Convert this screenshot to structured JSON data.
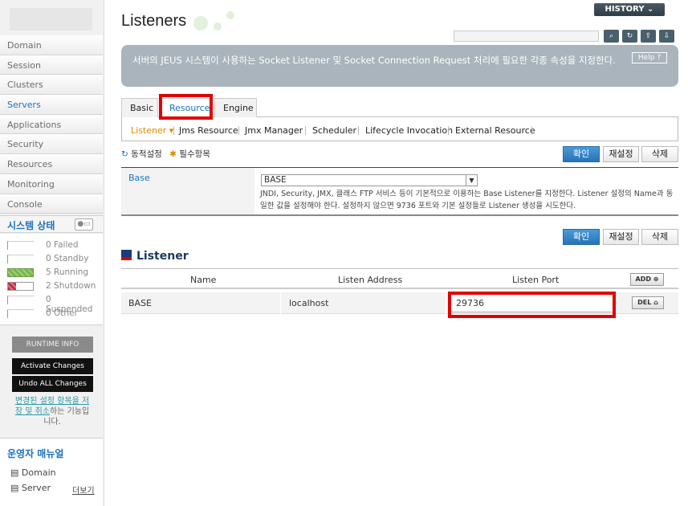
{
  "sidebar": {
    "items": [
      {
        "label": "Domain",
        "active": false
      },
      {
        "label": "Session",
        "active": false
      },
      {
        "label": "Clusters",
        "active": false
      },
      {
        "label": "Servers",
        "active": true
      },
      {
        "label": "Applications",
        "active": false
      },
      {
        "label": "Security",
        "active": false
      },
      {
        "label": "Resources",
        "active": false
      },
      {
        "label": "Monitoring",
        "active": false
      },
      {
        "label": "Console",
        "active": false
      }
    ],
    "system_status": {
      "title": "시스템 상태",
      "rows": [
        {
          "count": "0",
          "label": "Failed"
        },
        {
          "count": "0",
          "label": "Standby"
        },
        {
          "count": "5",
          "label": "Running"
        },
        {
          "count": "2",
          "label": "Shutdown"
        },
        {
          "count": "0",
          "label": "Suspended"
        },
        {
          "count": "0",
          "label": "Other"
        }
      ]
    },
    "runtime_info_label": "RUNTIME INFO",
    "activate_label": "Activate Changes",
    "undo_label": "Undo ALL Changes",
    "note_link": "변경된 설정 항목을 저장 및 취소",
    "note_rest": "하는 기능입니다.",
    "manual": {
      "title": "운영자 매뉴얼",
      "links": [
        "Domain",
        "Server"
      ],
      "more": "더보기"
    }
  },
  "header": {
    "title": "Listeners",
    "history_label": "HISTORY",
    "description": "서버의 JEUS 시스템이 사용하는 Socket Listener 및 Socket Connection Request 처리에 필요한 각종 속성을 지정한다.",
    "help_label": "Help"
  },
  "tabs": [
    "Basic",
    "Resource",
    "Engine"
  ],
  "subnav": [
    "Listener",
    "Jms Resource",
    "Jmx Manager",
    "Scheduler",
    "Lifecycle Invocation",
    "External Resource"
  ],
  "legend": {
    "dynamic": "동적설정",
    "required": "필수항목"
  },
  "buttons": {
    "ok": "확인",
    "reset": "재설정",
    "delete": "삭제"
  },
  "form": {
    "label": "Base",
    "value": "BASE",
    "description": "JNDI, Security, JMX, 클래스 FTP 서비스 등이 기본적으로 이용하는 Base Listener를 지정한다. Listener 설정의 Name과 동일한 값을 설정해야 한다. 설정하지 않으면 9736 포트와 기본 설정들로 Listener 생성을 시도한다."
  },
  "listener_section": {
    "title": "Listener",
    "columns": [
      "Name",
      "Listen Address",
      "Listen Port"
    ],
    "add_label": "ADD",
    "rows": [
      {
        "name": "BASE",
        "address": "localhost",
        "port": "29736",
        "del_label": "DEL"
      }
    ]
  },
  "colors": {
    "accent": "#1a72c0",
    "highlight": "#e10000"
  }
}
